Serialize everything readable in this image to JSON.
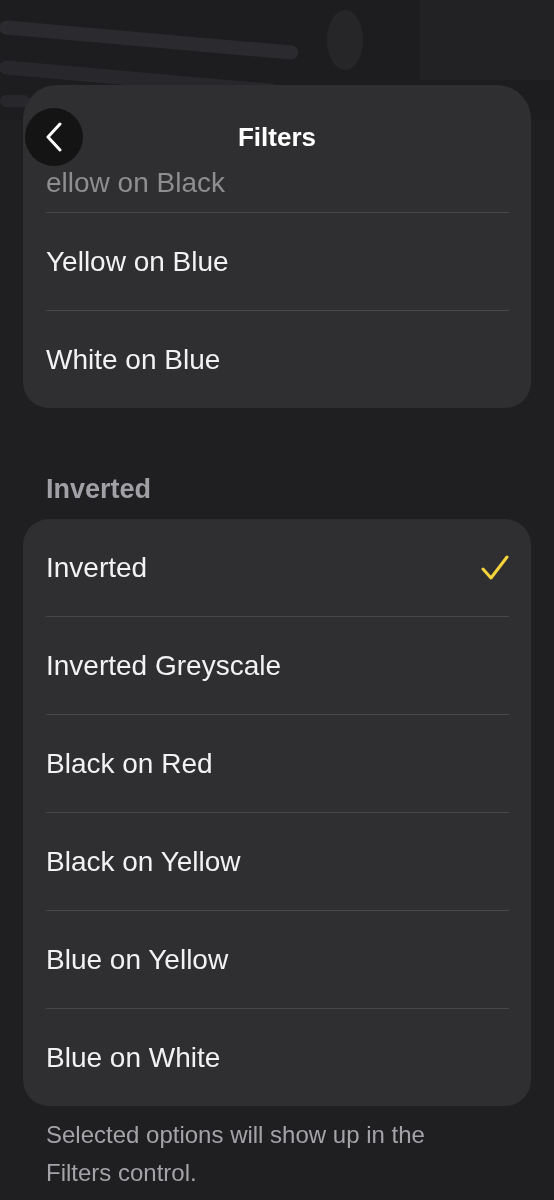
{
  "header": {
    "title": "Filters"
  },
  "sections": [
    {
      "options": [
        {
          "label": "ellow on Black",
          "selected": false,
          "faded": true
        },
        {
          "label": "Yellow on Blue",
          "selected": false,
          "faded": false
        },
        {
          "label": "White on Blue",
          "selected": false,
          "faded": false
        }
      ]
    },
    {
      "heading": "Inverted",
      "options": [
        {
          "label": "Inverted",
          "selected": true,
          "faded": false
        },
        {
          "label": "Inverted Greyscale",
          "selected": false,
          "faded": false
        },
        {
          "label": "Black on Red",
          "selected": false,
          "faded": false
        },
        {
          "label": "Black on Yellow",
          "selected": false,
          "faded": false
        },
        {
          "label": "Blue on Yellow",
          "selected": false,
          "faded": false
        },
        {
          "label": "Blue on White",
          "selected": false,
          "faded": false
        }
      ]
    }
  ],
  "footer": "Selected options will show up in the Filters control."
}
